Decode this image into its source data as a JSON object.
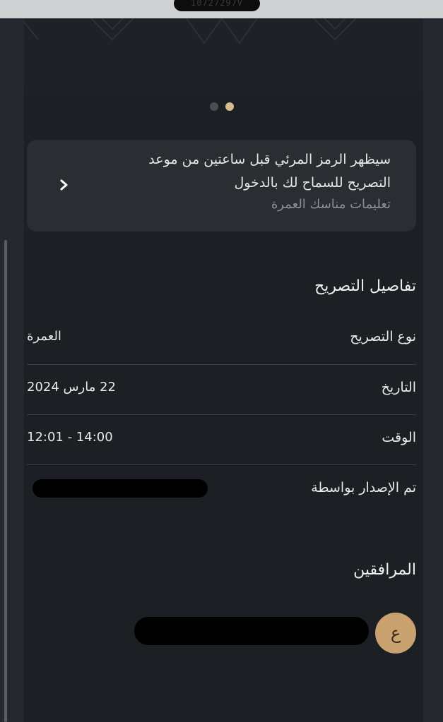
{
  "status_bar": {
    "text": "10727297V"
  },
  "carousel": {
    "page_count": 2,
    "active_index": 1
  },
  "notice": {
    "line1": "سيظهر الرمز المرئي قبل ساعتين من موعد",
    "line2": "التصريح للسماح لك بالدخول",
    "link": "تعليمات مناسك العمرة",
    "chevron_icon": "chevron-right-icon"
  },
  "permit_details": {
    "title": "تفاصيل التصريح",
    "rows": [
      {
        "label": "نوع التصريح",
        "value": "العمرة"
      },
      {
        "label": "التاريخ",
        "value": "22 مارس 2024"
      },
      {
        "label": "الوقت",
        "value": "12:01 - 14:00"
      },
      {
        "label": "تم الإصدار بواسطة",
        "value": ""
      }
    ]
  },
  "companions": {
    "title": "المرافقين",
    "items": [
      {
        "initial": "ع",
        "name": ""
      }
    ]
  },
  "colors": {
    "background": "#1c1f24",
    "card": "#2a2d32",
    "accent": "#d9bb90",
    "avatar": "#c9a26f",
    "muted_text": "#8d9095"
  }
}
